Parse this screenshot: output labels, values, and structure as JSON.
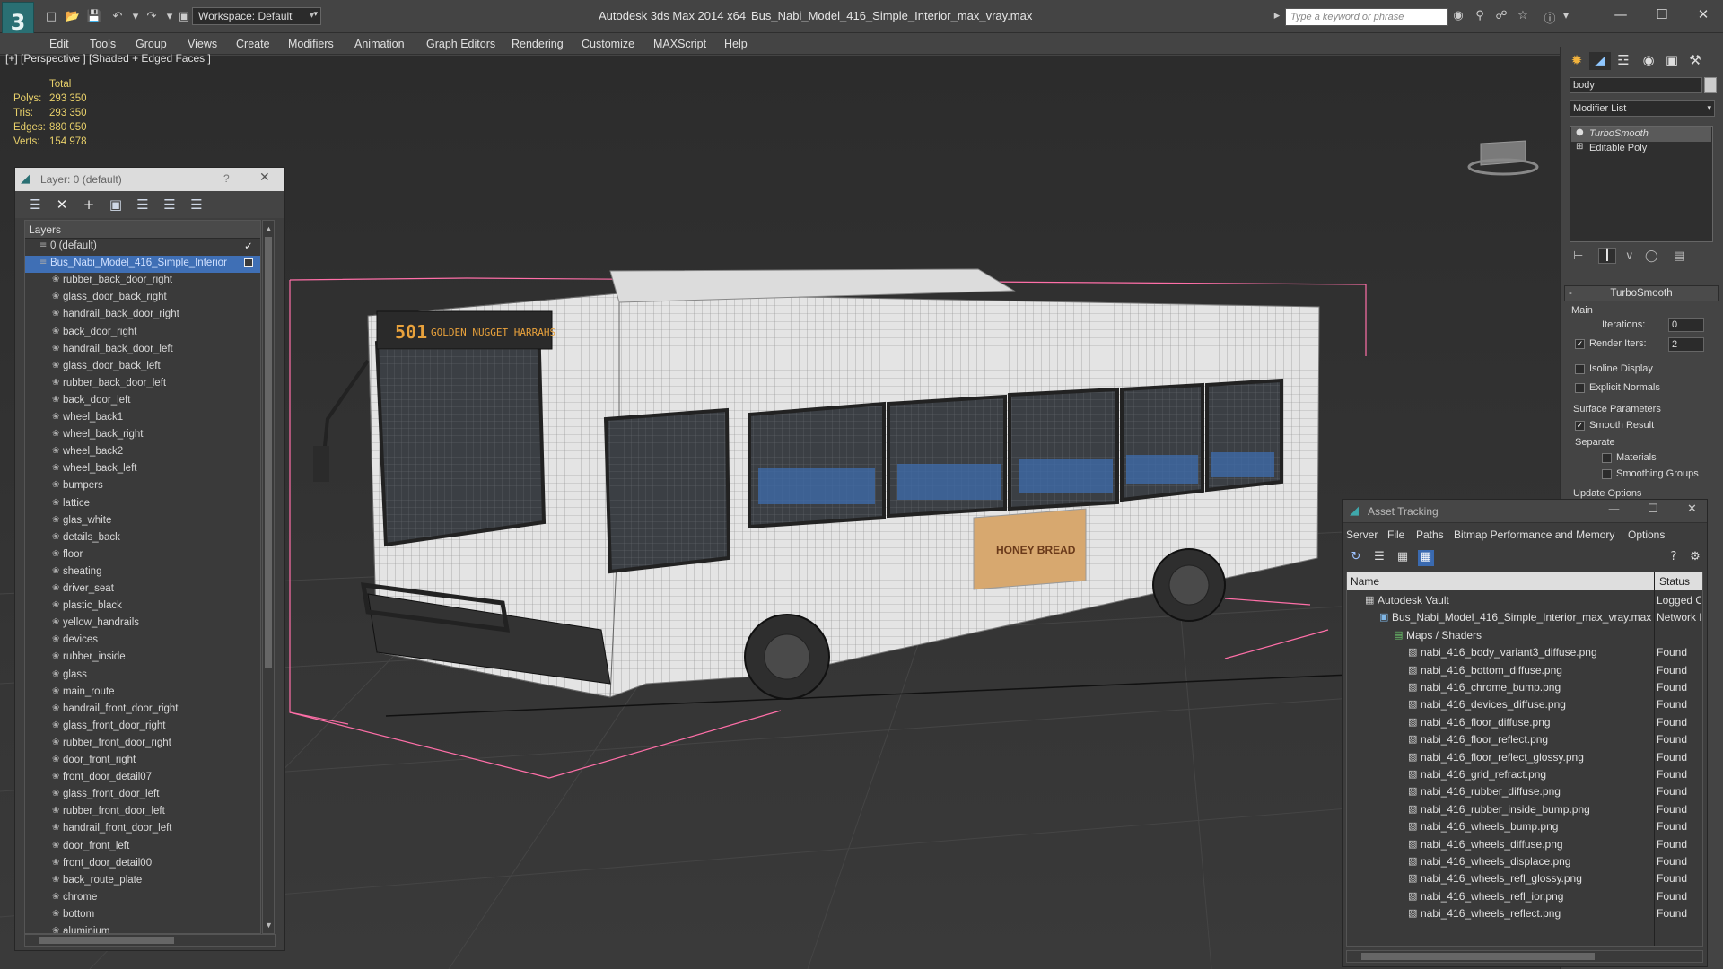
{
  "titlebar": {
    "app_name": "Autodesk 3ds Max  2014 x64",
    "file_name": "Bus_Nabi_Model_416_Simple_Interior_max_vray.max",
    "workspace": "Workspace: Default",
    "search_placeholder": "Type a keyword or phrase"
  },
  "menu": [
    "Edit",
    "Tools",
    "Group",
    "Views",
    "Create",
    "Modifiers",
    "Animation",
    "Graph Editors",
    "Rendering",
    "Customize",
    "MAXScript",
    "Help"
  ],
  "viewport": {
    "label": "[+] [Perspective ] [Shaded + Edged Faces ]",
    "stats": {
      "header": "Total",
      "rows": [
        {
          "label": "Polys:",
          "value": "293 350"
        },
        {
          "label": "Tris:",
          "value": "293 350"
        },
        {
          "label": "Edges:",
          "value": "880 050"
        },
        {
          "label": "Verts:",
          "value": "154 978"
        }
      ]
    },
    "bus_sign": {
      "route": "501",
      "text": "GOLDEN NUGGET HARRAHS"
    },
    "ad_text": "HONEY BREAD"
  },
  "layer_panel": {
    "title": "Layer: 0 (default)",
    "help": "?",
    "column": "Layers",
    "default_layer": "0 (default)",
    "selected_layer": "Bus_Nabi_Model_416_Simple_Interior",
    "items": [
      "rubber_back_door_right",
      "glass_door_back_right",
      "handrail_back_door_right",
      "back_door_right",
      "handrail_back_door_left",
      "glass_door_back_left",
      "rubber_back_door_left",
      "back_door_left",
      "wheel_back1",
      "wheel_back_right",
      "wheel_back2",
      "wheel_back_left",
      "bumpers",
      "lattice",
      "glas_white",
      "details_back",
      "floor",
      "sheating",
      "driver_seat",
      "plastic_black",
      "yellow_handrails",
      "devices",
      "rubber_inside",
      "glass",
      "main_route",
      "handrail_front_door_right",
      "glass_front_door_right",
      "rubber_front_door_right",
      "door_front_right",
      "front_door_detail07",
      "glass_front_door_left",
      "rubber_front_door_left",
      "handrail_front_door_left",
      "door_front_left",
      "front_door_detail00",
      "back_route_plate",
      "chrome",
      "bottom",
      "aluminium"
    ]
  },
  "command_panel": {
    "object_name": "body",
    "modifier_list": "Modifier List",
    "stack": [
      "TurboSmooth",
      "Editable Poly"
    ],
    "rollout_title": "TurboSmooth",
    "main_group": "Main",
    "iterations_label": "Iterations:",
    "iterations_value": "0",
    "render_iters_label": "Render Iters:",
    "render_iters_value": "2",
    "isoline": "Isoline Display",
    "explicit_normals": "Explicit Normals",
    "surface_params": "Surface Parameters",
    "smooth_result": "Smooth Result",
    "separate": "Separate",
    "materials": "Materials",
    "smoothing_groups": "Smoothing Groups",
    "update_options": "Update Options"
  },
  "asset_tracking": {
    "title": "Asset Tracking",
    "menus": [
      "Server",
      "File",
      "Paths",
      "Bitmap Performance and Memory",
      "Options"
    ],
    "col_name": "Name",
    "col_status": "Status",
    "rows": [
      {
        "name": "Autodesk Vault",
        "status": "Logged O",
        "indent": 0
      },
      {
        "name": "Bus_Nabi_Model_416_Simple_Interior_max_vray.max",
        "status": "Network P",
        "indent": 1
      },
      {
        "name": "Maps / Shaders",
        "status": "",
        "indent": 2
      },
      {
        "name": "nabi_416_body_variant3_diffuse.png",
        "status": "Found",
        "indent": 3
      },
      {
        "name": "nabi_416_bottom_diffuse.png",
        "status": "Found",
        "indent": 3
      },
      {
        "name": "nabi_416_chrome_bump.png",
        "status": "Found",
        "indent": 3
      },
      {
        "name": "nabi_416_devices_diffuse.png",
        "status": "Found",
        "indent": 3
      },
      {
        "name": "nabi_416_floor_diffuse.png",
        "status": "Found",
        "indent": 3
      },
      {
        "name": "nabi_416_floor_reflect.png",
        "status": "Found",
        "indent": 3
      },
      {
        "name": "nabi_416_floor_reflect_glossy.png",
        "status": "Found",
        "indent": 3
      },
      {
        "name": "nabi_416_grid_refract.png",
        "status": "Found",
        "indent": 3
      },
      {
        "name": "nabi_416_rubber_diffuse.png",
        "status": "Found",
        "indent": 3
      },
      {
        "name": "nabi_416_rubber_inside_bump.png",
        "status": "Found",
        "indent": 3
      },
      {
        "name": "nabi_416_wheels_bump.png",
        "status": "Found",
        "indent": 3
      },
      {
        "name": "nabi_416_wheels_diffuse.png",
        "status": "Found",
        "indent": 3
      },
      {
        "name": "nabi_416_wheels_displace.png",
        "status": "Found",
        "indent": 3
      },
      {
        "name": "nabi_416_wheels_refl_glossy.png",
        "status": "Found",
        "indent": 3
      },
      {
        "name": "nabi_416_wheels_refl_ior.png",
        "status": "Found",
        "indent": 3
      },
      {
        "name": "nabi_416_wheels_reflect.png",
        "status": "Found",
        "indent": 3
      }
    ]
  }
}
